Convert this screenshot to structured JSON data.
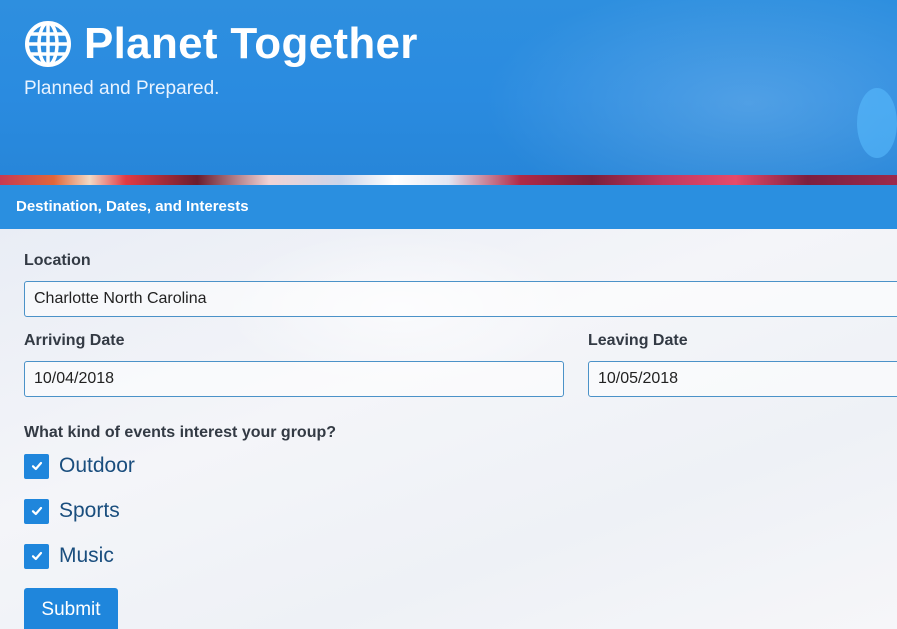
{
  "header": {
    "title": "Planet Together",
    "tagline": "Planned and Prepared.",
    "logo_icon": "globe-icon"
  },
  "section": {
    "title": "Destination, Dates, and Interests"
  },
  "form": {
    "location": {
      "label": "Location",
      "value": "Charlotte North Carolina"
    },
    "arriving": {
      "label": "Arriving Date",
      "value": "10/04/2018"
    },
    "leaving": {
      "label": "Leaving Date",
      "value": "10/05/2018"
    },
    "interests_question": "What kind of events interest your group?",
    "interests": [
      {
        "label": "Outdoor",
        "checked": true
      },
      {
        "label": "Sports",
        "checked": true
      },
      {
        "label": "Music",
        "checked": true
      }
    ],
    "submit_label": "Submit"
  },
  "colors": {
    "header_blue": "#2a8be0",
    "accent_blue": "#1f86dc",
    "input_border": "#4b92c8",
    "checkbox_label": "#1a4e7e"
  }
}
